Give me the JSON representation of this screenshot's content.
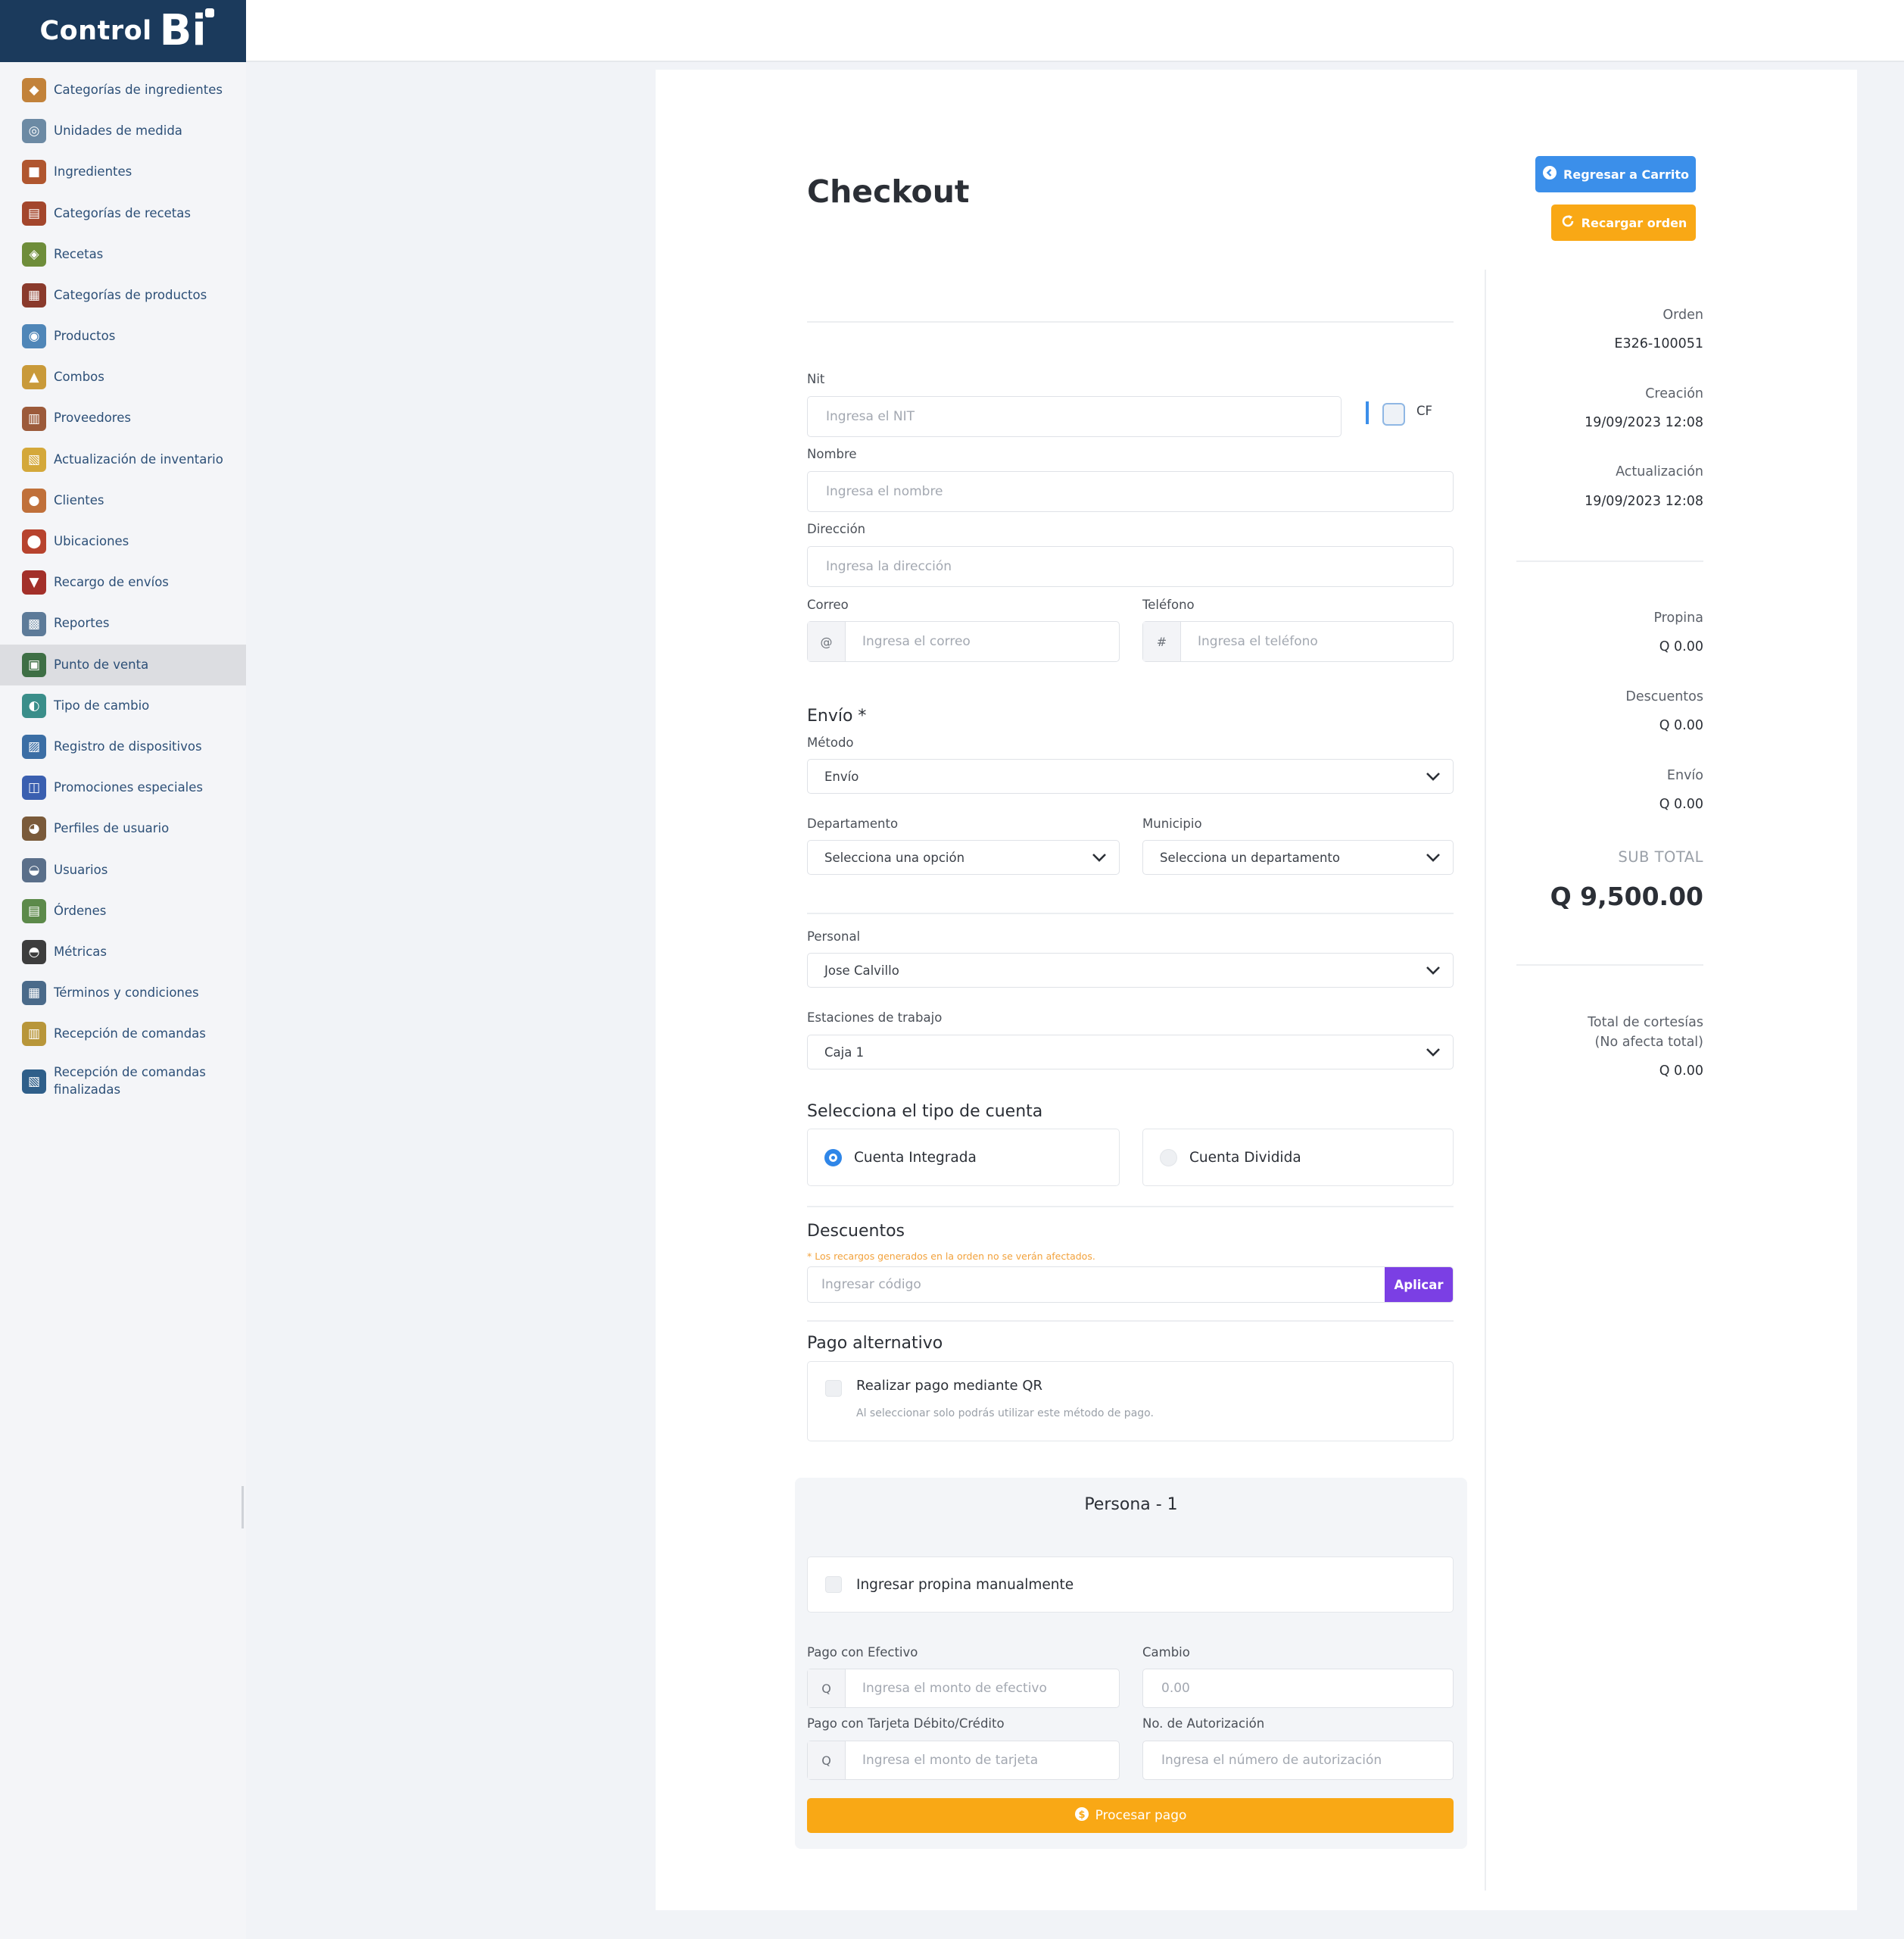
{
  "brand": {
    "name_part1": "Control",
    "name_part2": "Bi"
  },
  "sidebar": {
    "items": [
      {
        "label": "Categorías de ingredientes",
        "icon": "ingredient-categories-icon",
        "color": "#c2823a"
      },
      {
        "label": "Unidades de medida",
        "icon": "measure-units-icon",
        "color": "#6c8aa4"
      },
      {
        "label": "Ingredientes",
        "icon": "ingredients-icon",
        "color": "#b0562f"
      },
      {
        "label": "Categorías de recetas",
        "icon": "recipe-categories-icon",
        "color": "#a3462c"
      },
      {
        "label": "Recetas",
        "icon": "recipes-icon",
        "color": "#6e8d3a"
      },
      {
        "label": "Categorías de productos",
        "icon": "product-categories-icon",
        "color": "#8a3a2c"
      },
      {
        "label": "Productos",
        "icon": "products-icon",
        "color": "#4f86b8"
      },
      {
        "label": "Combos",
        "icon": "combos-icon",
        "color": "#c99a3a"
      },
      {
        "label": "Proveedores",
        "icon": "suppliers-icon",
        "color": "#9c5a3a"
      },
      {
        "label": "Actualización de inventario",
        "icon": "inventory-update-icon",
        "color": "#d4a83a"
      },
      {
        "label": "Clientes",
        "icon": "clients-icon",
        "color": "#c0703a"
      },
      {
        "label": "Ubicaciones",
        "icon": "locations-icon",
        "color": "#b7432e"
      },
      {
        "label": "Recargo de envíos",
        "icon": "shipping-surcharge-icon",
        "color": "#a3302a"
      },
      {
        "label": "Reportes",
        "icon": "reports-icon",
        "color": "#5d7b99"
      },
      {
        "label": "Punto de venta",
        "icon": "point-of-sale-icon",
        "color": "#3e6f45"
      },
      {
        "label": "Tipo de cambio",
        "icon": "exchange-rate-icon",
        "color": "#3a8e8a"
      },
      {
        "label": "Registro de dispositivos",
        "icon": "device-registry-icon",
        "color": "#3b6ea5"
      },
      {
        "label": "Promociones especiales",
        "icon": "promotions-icon",
        "color": "#3a5fb0"
      },
      {
        "label": "Perfiles de usuario",
        "icon": "user-profiles-icon",
        "color": "#7a5a3a"
      },
      {
        "label": "Usuarios",
        "icon": "users-icon",
        "color": "#5a6f8a"
      },
      {
        "label": "Órdenes",
        "icon": "orders-icon",
        "color": "#5c8a4a"
      },
      {
        "label": "Métricas",
        "icon": "metrics-icon",
        "color": "#3d3d3d"
      },
      {
        "label": "Términos y condiciones",
        "icon": "terms-icon",
        "color": "#4a6a8a"
      },
      {
        "label": "Recepción de comandas",
        "icon": "order-reception-icon",
        "color": "#b8963a"
      },
      {
        "label": "Recepción de comandas finalizadas",
        "icon": "finished-orders-icon",
        "color": "#2f5f8a"
      }
    ],
    "active_index": 14
  },
  "page": {
    "title": "Checkout"
  },
  "actions": {
    "back_to_cart": "Regresar a Carrito",
    "reload_order": "Recargar orden",
    "blue": "#3b8fea",
    "orange": "#f9a815"
  },
  "form": {
    "nit": {
      "label": "Nit",
      "placeholder": "Ingresa el NIT",
      "cf_label": "CF"
    },
    "name": {
      "label": "Nombre",
      "placeholder": "Ingresa el nombre"
    },
    "address": {
      "label": "Dirección",
      "placeholder": "Ingresa la dirección"
    },
    "email": {
      "label": "Correo",
      "prefix": "@",
      "placeholder": "Ingresa el correo"
    },
    "phone": {
      "label": "Teléfono",
      "prefix": "#",
      "placeholder": "Ingresa el teléfono"
    },
    "shipping": {
      "title": "Envío *",
      "method_label": "Método",
      "method_value": "Envío",
      "department_label": "Departamento",
      "department_value": "Selecciona una opción",
      "municipality_label": "Municipio",
      "municipality_value": "Selecciona un departamento"
    },
    "staff": {
      "label": "Personal",
      "value": "Jose Calvillo"
    },
    "workstation": {
      "label": "Estaciones de trabajo",
      "value": "Caja 1"
    },
    "account_type": {
      "title": "Selecciona el tipo de cuenta",
      "integrated": "Cuenta Integrada",
      "split": "Cuenta Dividida",
      "selected": "integrated"
    },
    "discounts": {
      "title": "Descuentos",
      "note": "* Los recargos generados en la orden no se verán afectados.",
      "placeholder": "Ingresar código",
      "apply": "Aplicar",
      "apply_color": "#7b3fe4"
    },
    "alt_payment": {
      "title": "Pago alternativo",
      "qr_label": "Realizar pago mediante QR",
      "qr_hint": "Al seleccionar solo podrás utilizar este método de pago."
    },
    "persona": {
      "title": "Persona - 1",
      "tip_manual": "Ingresar propina manualmente",
      "cash_label": "Pago con Efectivo",
      "cash_prefix": "Q",
      "cash_placeholder": "Ingresa el monto de efectivo",
      "change_label": "Cambio",
      "change_value": "0.00",
      "card_label": "Pago con Tarjeta Débito/Crédito",
      "card_prefix": "Q",
      "card_placeholder": "Ingresa el monto de tarjeta",
      "auth_label": "No. de Autorización",
      "auth_placeholder": "Ingresa el número de autorización",
      "process": "Procesar pago"
    }
  },
  "summary": {
    "order_label": "Orden",
    "order_value": "E326-100051",
    "created_label": "Creación",
    "created_value": "19/09/2023 12:08",
    "updated_label": "Actualización",
    "updated_value": "19/09/2023 12:08",
    "tip_label": "Propina",
    "tip_value": "Q 0.00",
    "discounts_label": "Descuentos",
    "discounts_value": "Q 0.00",
    "shipping_label": "Envío",
    "shipping_value": "Q 0.00",
    "subtotal_label": "SUB TOTAL",
    "subtotal_value": "Q 9,500.00",
    "courtesy_label_1": "Total de cortesías",
    "courtesy_label_2": "(No afecta total)",
    "courtesy_value": "Q 0.00"
  }
}
